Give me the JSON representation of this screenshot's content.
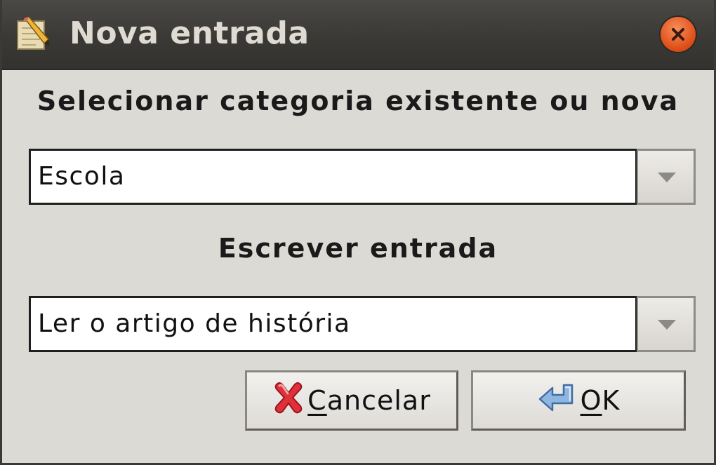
{
  "window": {
    "title": "Nova entrada",
    "title_icon": "pencil-notepad-icon",
    "close_icon": "close-icon"
  },
  "category": {
    "label": "Selecionar categoria existente ou nova",
    "value": "Escola",
    "dropdown_icon": "chevron-down-icon"
  },
  "entry": {
    "label": "Escrever entrada",
    "value": "Ler o artigo de história",
    "dropdown_icon": "chevron-down-icon"
  },
  "buttons": {
    "cancel": {
      "mnemonic": "C",
      "rest": "ancelar",
      "icon": "red-x-icon"
    },
    "ok": {
      "mnemonic": "O",
      "rest": "K",
      "icon": "return-arrow-icon"
    }
  },
  "colors": {
    "titlebar": "#3a3936",
    "close_button": "#e2531d",
    "background": "#dcdad5",
    "cancel_icon": "#e0303a",
    "ok_icon": "#7aa6d8"
  }
}
